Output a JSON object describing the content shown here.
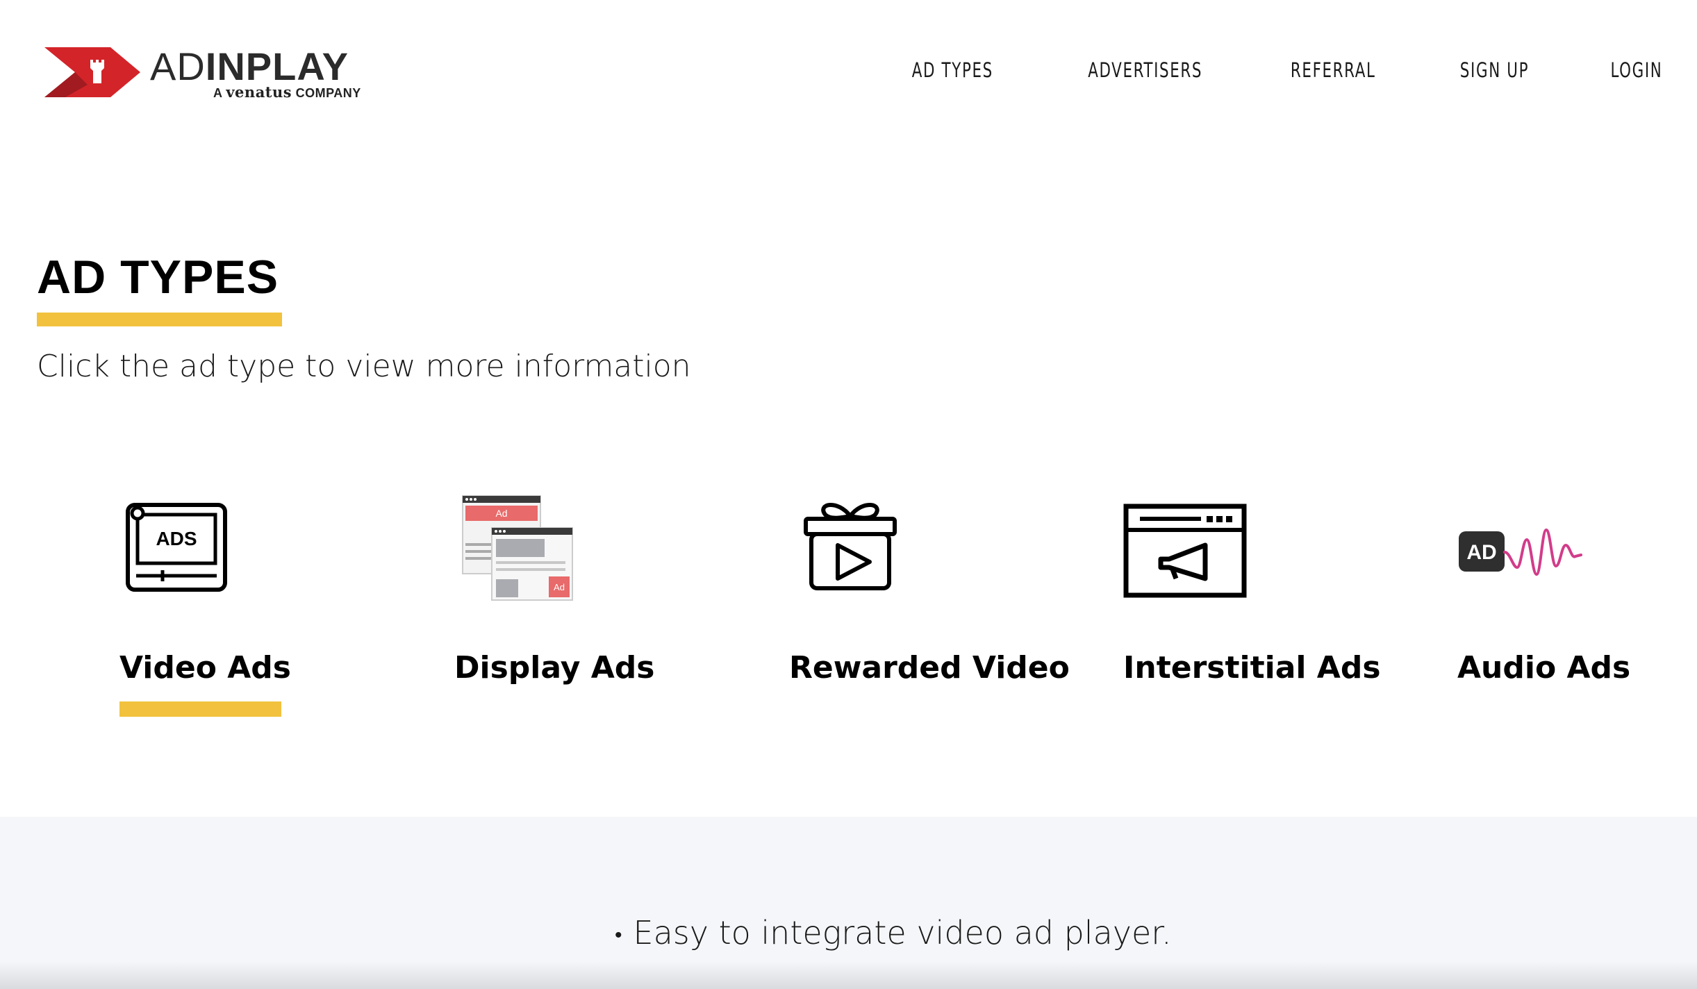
{
  "brand": {
    "logo_ad": "AD",
    "logo_inplay": "INPLAY",
    "logo_sub_prefix": "A",
    "logo_sub_brand": "venatus",
    "logo_sub_suffix": "COMPANY",
    "logo_icon": "castle-tower-arrow-icon",
    "colors": {
      "red": "#d3242a",
      "dark_red": "#a11b20",
      "text": "#2b2b2b"
    }
  },
  "nav": {
    "items": [
      {
        "label": "AD TYPES"
      },
      {
        "label": "ADVERTISERS"
      },
      {
        "label": "REFERRAL"
      },
      {
        "label": "SIGN UP"
      },
      {
        "label": "LOGIN"
      }
    ]
  },
  "main": {
    "title": "AD TYPES",
    "subtitle": "Click the ad type to view more information",
    "accent_color": "#f2c23e",
    "ad_types": [
      {
        "label": "Video Ads",
        "icon": "video-ads-icon",
        "selected": true
      },
      {
        "label": "Display Ads",
        "icon": "display-ads-icon",
        "selected": false
      },
      {
        "label": "Rewarded Video",
        "icon": "rewarded-video-gift-icon",
        "selected": false
      },
      {
        "label": "Interstitial Ads",
        "icon": "interstitial-megaphone-icon",
        "selected": false
      },
      {
        "label": "Audio Ads",
        "icon": "audio-ads-wave-icon",
        "selected": false
      }
    ]
  },
  "details": {
    "bullets": [
      "Easy to integrate video ad player."
    ],
    "background": "#f5f6f9"
  }
}
